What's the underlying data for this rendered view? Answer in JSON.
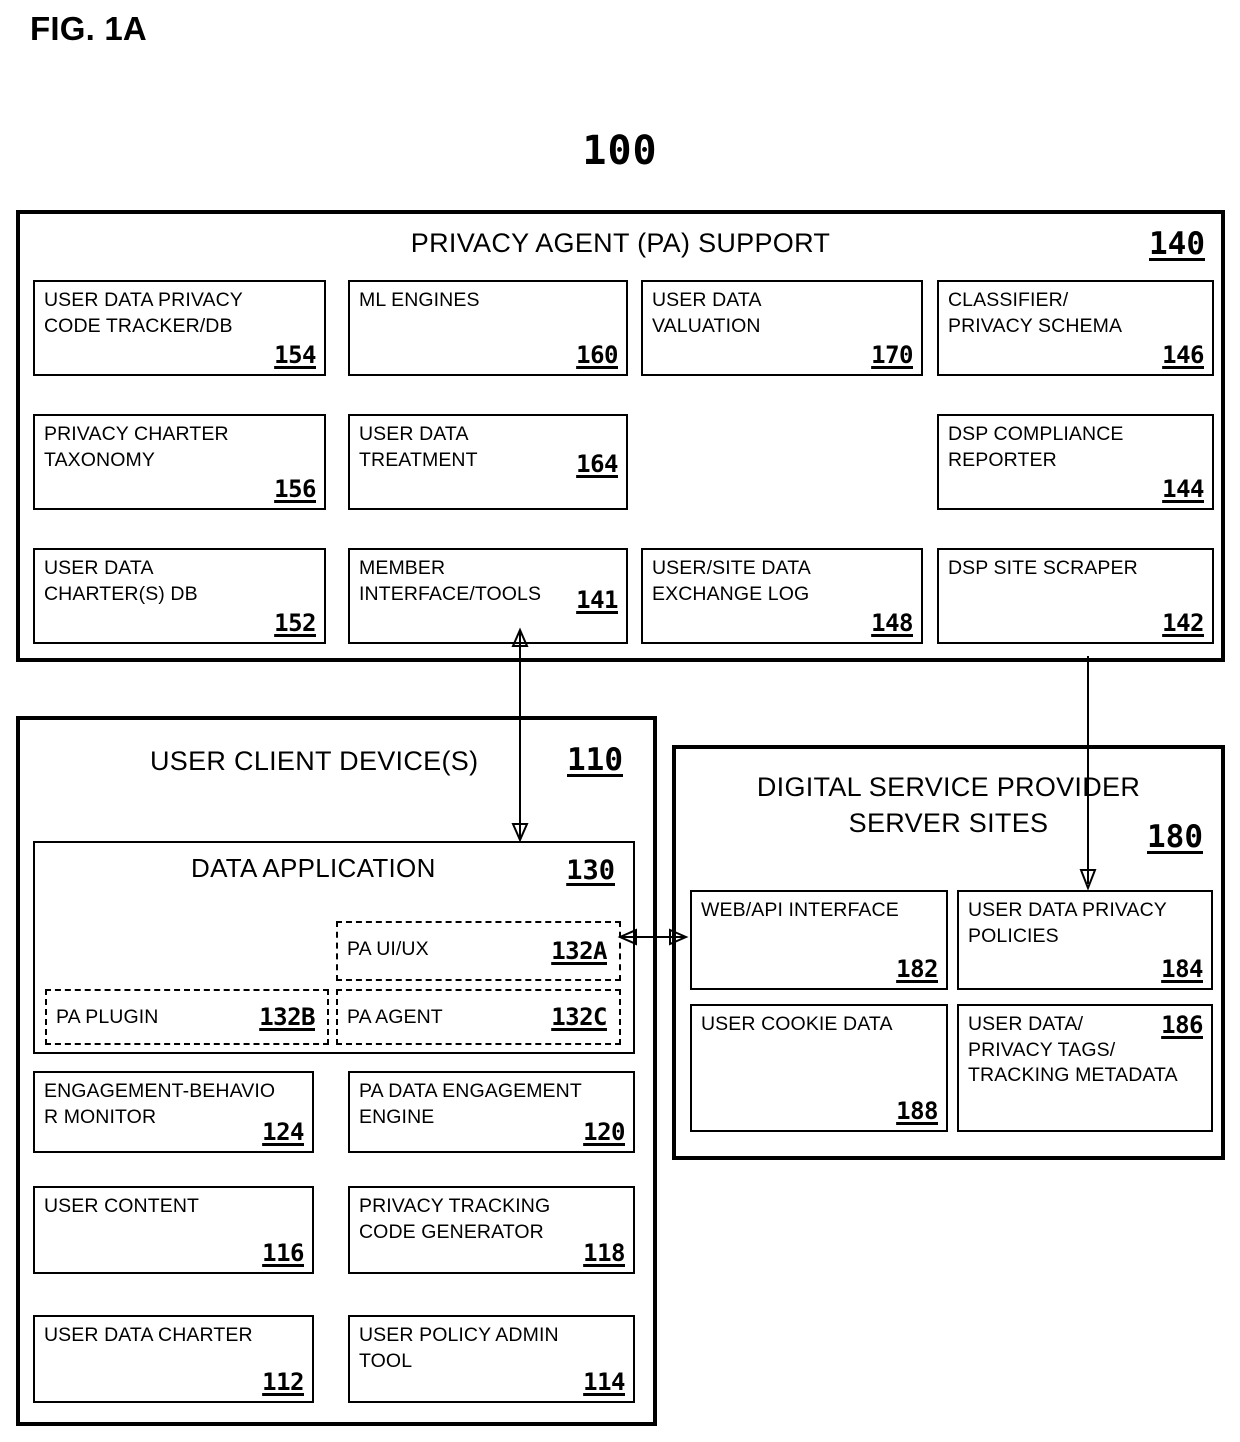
{
  "figure": {
    "label": "FIG. 1A",
    "number": "100"
  },
  "pa_support": {
    "title": "PRIVACY AGENT (PA) SUPPORT",
    "ref": "140",
    "components": [
      {
        "label": "USER DATA PRIVACY\nCODE TRACKER/DB",
        "ref": "154"
      },
      {
        "label": "ML ENGINES",
        "ref": "160"
      },
      {
        "label": "USER DATA\nVALUATION",
        "ref": "170"
      },
      {
        "label": "CLASSIFIER/\nPRIVACY SCHEMA",
        "ref": "146"
      },
      {
        "label": "PRIVACY CHARTER\nTAXONOMY",
        "ref": "156"
      },
      {
        "label": "USER DATA\nTREATMENT",
        "ref": "164"
      },
      {
        "label": "DSP COMPLIANCE\nREPORTER",
        "ref": "144"
      },
      {
        "label": "USER DATA\nCHARTER(S) DB",
        "ref": "152"
      },
      {
        "label": "MEMBER\nINTERFACE/TOOLS",
        "ref": "141"
      },
      {
        "label": "USER/SITE DATA\nEXCHANGE LOG",
        "ref": "148"
      },
      {
        "label": "DSP SITE SCRAPER",
        "ref": "142"
      }
    ]
  },
  "user_client_device": {
    "title": "USER CLIENT DEVICE(S)",
    "ref": "110",
    "data_application": {
      "title": "DATA APPLICATION",
      "ref": "130",
      "components": [
        {
          "label": "PA UI/UX",
          "ref": "132A"
        },
        {
          "label": "PA PLUGIN",
          "ref": "132B"
        },
        {
          "label": "PA AGENT",
          "ref": "132C"
        }
      ]
    },
    "components": [
      {
        "label": "ENGAGEMENT-BEHAVIO\nR MONITOR",
        "ref": "124"
      },
      {
        "label": "PA DATA ENGAGEMENT\nENGINE",
        "ref": "120"
      },
      {
        "label": "USER CONTENT",
        "ref": "116"
      },
      {
        "label": "PRIVACY TRACKING\nCODE GENERATOR",
        "ref": "118"
      },
      {
        "label": "USER DATA CHARTER",
        "ref": "112"
      },
      {
        "label": "USER POLICY ADMIN\nTOOL",
        "ref": "114"
      }
    ]
  },
  "dsp_server_sites": {
    "title": "DIGITAL SERVICE PROVIDER\nSERVER SITES",
    "ref": "180",
    "components": [
      {
        "label": "WEB/API INTERFACE",
        "ref": "182"
      },
      {
        "label": "USER DATA PRIVACY\nPOLICIES",
        "ref": "184"
      },
      {
        "label": "USER COOKIE DATA",
        "ref": "188"
      },
      {
        "label": "USER DATA/\nPRIVACY TAGS/\nTRACKING METADATA",
        "ref": "186"
      }
    ]
  },
  "connectors": [
    {
      "name": "pa-support-to-data-application",
      "kind": "double-arrow-vertical"
    },
    {
      "name": "dsp-site-scraper-to-user-data-privacy-policies",
      "kind": "single-arrow-down"
    },
    {
      "name": "pa-ui-ux-to-web-api-interface",
      "kind": "double-arrow-horizontal"
    }
  ]
}
